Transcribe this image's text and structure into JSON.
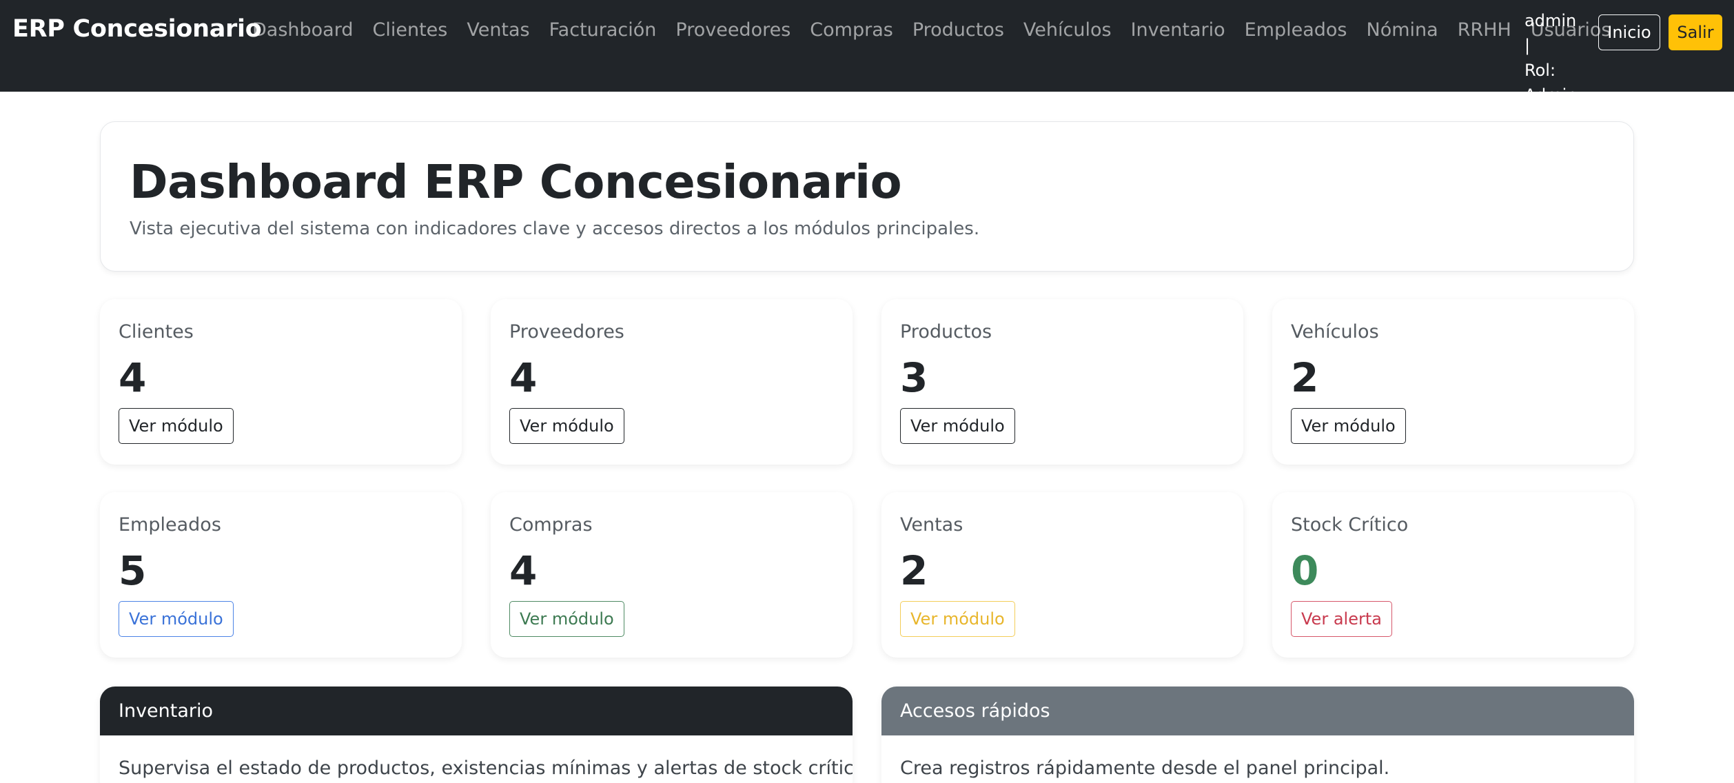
{
  "navbar": {
    "brand": "ERP Concesionario",
    "links": [
      "Dashboard",
      "Clientes",
      "Ventas",
      "Facturación",
      "Proveedores",
      "Compras",
      "Productos",
      "Vehículos",
      "Inventario",
      "Empleados",
      "Nómina",
      "RRHH",
      "Usuarios"
    ],
    "user_line1": "admin |",
    "user_line2": "Rol:",
    "user_line3": "Admin",
    "inicio_label": "Inicio",
    "salir_label": "Salir"
  },
  "hero": {
    "title": "Dashboard ERP Concesionario",
    "subtitle": "Vista ejecutiva del sistema con indicadores clave y accesos directos a los módulos principales."
  },
  "stats": [
    {
      "label": "Clientes",
      "value": "4",
      "button": "Ver módulo",
      "style": "dark"
    },
    {
      "label": "Proveedores",
      "value": "4",
      "button": "Ver módulo",
      "style": "dark"
    },
    {
      "label": "Productos",
      "value": "3",
      "button": "Ver módulo",
      "style": "dark"
    },
    {
      "label": "Vehículos",
      "value": "2",
      "button": "Ver módulo",
      "style": "dark"
    },
    {
      "label": "Empleados",
      "value": "5",
      "button": "Ver módulo",
      "style": "primary"
    },
    {
      "label": "Compras",
      "value": "4",
      "button": "Ver módulo",
      "style": "success"
    },
    {
      "label": "Ventas",
      "value": "2",
      "button": "Ver módulo",
      "style": "warning"
    },
    {
      "label": "Stock Crítico",
      "value": "0",
      "button": "Ver alerta",
      "style": "danger"
    }
  ],
  "panels": {
    "inventory": {
      "title": "Inventario",
      "text": "Supervisa el estado de productos, existencias mínimas y alertas de stock crítico."
    },
    "quick_access": {
      "title": "Accesos rápidos",
      "text": "Crea registros rápidamente desde el panel principal."
    }
  },
  "colors": {
    "navbar_bg": "#212529",
    "accent_warning": "#ffc107",
    "primary": "#0d6efd",
    "success": "#198754",
    "danger": "#dc3545",
    "secondary": "#6c757d"
  }
}
